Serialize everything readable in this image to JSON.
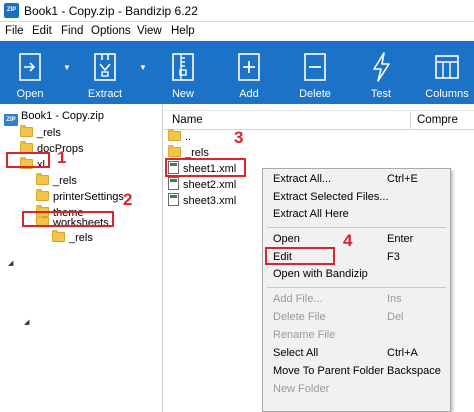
{
  "window": {
    "title": "Book1 - Copy.zip - Bandizip 6.22",
    "icon": "zip-icon"
  },
  "menu": [
    "File",
    "Edit",
    "Find",
    "Options",
    "View",
    "Help"
  ],
  "toolbar": [
    {
      "label": "Open",
      "icon": "open-icon"
    },
    {
      "label": "Extract",
      "icon": "extract-icon"
    },
    {
      "label": "New",
      "icon": "new-archive-icon"
    },
    {
      "label": "Add",
      "icon": "add-icon"
    },
    {
      "label": "Delete",
      "icon": "delete-icon"
    },
    {
      "label": "Test",
      "icon": "test-icon"
    },
    {
      "label": "Columns",
      "icon": "columns-icon"
    }
  ],
  "tree": {
    "root": "Book1 - Copy.zip",
    "items": [
      "_rels",
      "docProps",
      "xl",
      "_rels",
      "printerSettings",
      "theme",
      "worksheets",
      "_rels"
    ]
  },
  "filelist": {
    "columns": [
      "Name",
      "Compre"
    ],
    "rows": [
      "..",
      "_rels",
      "sheet1.xml",
      "sheet2.xml",
      "sheet3.xml"
    ]
  },
  "context_menu": [
    {
      "label": "Extract All...",
      "shortcut": "Ctrl+E",
      "enabled": true
    },
    {
      "label": "Extract Selected Files...",
      "shortcut": "",
      "enabled": true
    },
    {
      "label": "Extract All Here",
      "shortcut": "",
      "enabled": true
    },
    {
      "label": "Open",
      "shortcut": "Enter",
      "enabled": true
    },
    {
      "label": "Edit",
      "shortcut": "F3",
      "enabled": true
    },
    {
      "label": "Open with Bandizip",
      "shortcut": "",
      "enabled": true
    },
    {
      "label": "Add File...",
      "shortcut": "Ins",
      "enabled": false
    },
    {
      "label": "Delete File",
      "shortcut": "Del",
      "enabled": false
    },
    {
      "label": "Rename File",
      "shortcut": "",
      "enabled": false
    },
    {
      "label": "Select All",
      "shortcut": "Ctrl+A",
      "enabled": true
    },
    {
      "label": "Move To Parent Folder",
      "shortcut": "Backspace",
      "enabled": true
    },
    {
      "label": "New Folder",
      "shortcut": "",
      "enabled": false
    }
  ],
  "annotations": [
    "1",
    "2",
    "3",
    "4"
  ],
  "colors": {
    "toolbar": "#1b72c6",
    "highlight": "#d9262c",
    "folder": "#f2c448"
  }
}
